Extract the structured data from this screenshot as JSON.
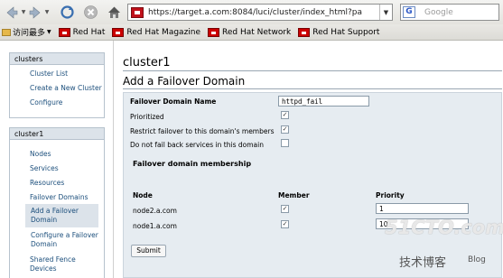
{
  "browser": {
    "url": "https://target.a.com:8084/luci/cluster/index_html?pa",
    "search_placeholder": "Google",
    "bookmarks": [
      {
        "label": "访问最多"
      },
      {
        "label": "Red Hat"
      },
      {
        "label": "Red Hat Magazine"
      },
      {
        "label": "Red Hat Network"
      },
      {
        "label": "Red Hat Support"
      }
    ]
  },
  "sidebar": {
    "clusters_header": "clusters",
    "clusters_items": [
      "Cluster List",
      "Create a New Cluster",
      "Configure"
    ],
    "cluster_header": "cluster1",
    "cluster_items": [
      "Nodes",
      "Services",
      "Resources",
      "Failover Domains"
    ],
    "sub_items": [
      "Add a Failover Domain",
      "Configure a Failover Domain"
    ],
    "shared_fence": "Shared Fence Devices"
  },
  "main": {
    "cluster_title": "cluster1",
    "section_title": "Add a Failover Domain",
    "form": {
      "name_label": "Failover Domain Name",
      "name_value": "httpd_fail",
      "prioritized_label": "Prioritized",
      "prioritized_checked": true,
      "restrict_label": "Restrict failover to this domain's members",
      "restrict_checked": true,
      "nofailback_label": "Do not fail back services in this domain",
      "nofailback_checked": false,
      "membership_title": "Failover domain membership",
      "columns": {
        "node": "Node",
        "member": "Member",
        "priority": "Priority"
      },
      "rows": [
        {
          "node": "node2.a.com",
          "member": true,
          "priority": "1"
        },
        {
          "node": "node1.a.com",
          "member": true,
          "priority": "10"
        }
      ],
      "submit_label": "Submit"
    }
  },
  "watermark": {
    "logo": "51CTO.com",
    "sub": "技术博客",
    "blog": "Blog"
  }
}
